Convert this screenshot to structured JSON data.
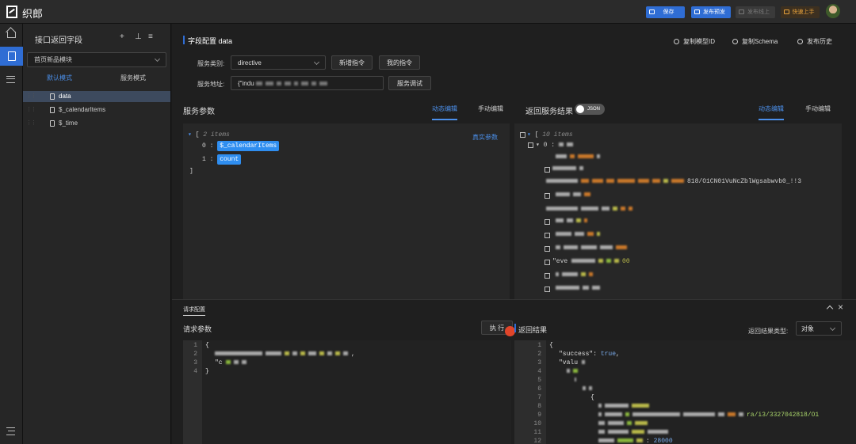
{
  "header": {
    "app_name": "织郎",
    "save": "保存",
    "publish_pre": "发布预发",
    "publish_online": "发布线上",
    "quick_start": "快速上手"
  },
  "sidebar": {
    "title": "接口返回字段",
    "module": "首页新品模块",
    "tab_default": "默认模式",
    "tab_service": "服务模式",
    "items": [
      {
        "label": "data"
      },
      {
        "label": "$_calendarItems"
      },
      {
        "label": "$_time"
      }
    ]
  },
  "main": {
    "title": "字段配置 data",
    "copy_model_id": "复制模型ID",
    "copy_schema": "复制Schema",
    "publish_history": "发布历史",
    "service_type_label": "服务类别:",
    "service_type": "directive",
    "new_cmd": "新增指令",
    "my_cmd": "我的指令",
    "service_addr_label": "服务地址:",
    "service_addr_prefix": "{\"indu",
    "service_debug": "服务调试",
    "params_title": "服务参数",
    "dynamic_edit": "动态编辑",
    "manual_edit": "手动编辑",
    "result_title": "返回服务结果",
    "json_toggle": "JSON",
    "params_count": "2 items",
    "param0": "$_calendarItems",
    "param1": "count",
    "real_params": "真实参数",
    "result_count": "10 items",
    "result_url_tail": "818/O1CN01VuNcZblWgsabwvb0_!!3",
    "result_eve": "\"eve",
    "result_num": "00"
  },
  "bottom": {
    "tab": "请求配置",
    "req_params": "请求参数",
    "run": "执 行",
    "result": "返回结果",
    "result_type_label": "返回结果类型:",
    "result_type": "对象",
    "req_lines": [
      "{",
      "",
      "\"c",
      "}"
    ],
    "res_code": {
      "success_key": "\"success\"",
      "success_val": "true",
      "value_key": "\"valu",
      "tail_url": "ra/i3/3327042818/O1",
      "price_num": "28000"
    }
  },
  "icons": [
    "home-icon",
    "document-icon",
    "list-icon",
    "menu-icon",
    "plus-icon",
    "download-icon",
    "sort-icon"
  ]
}
